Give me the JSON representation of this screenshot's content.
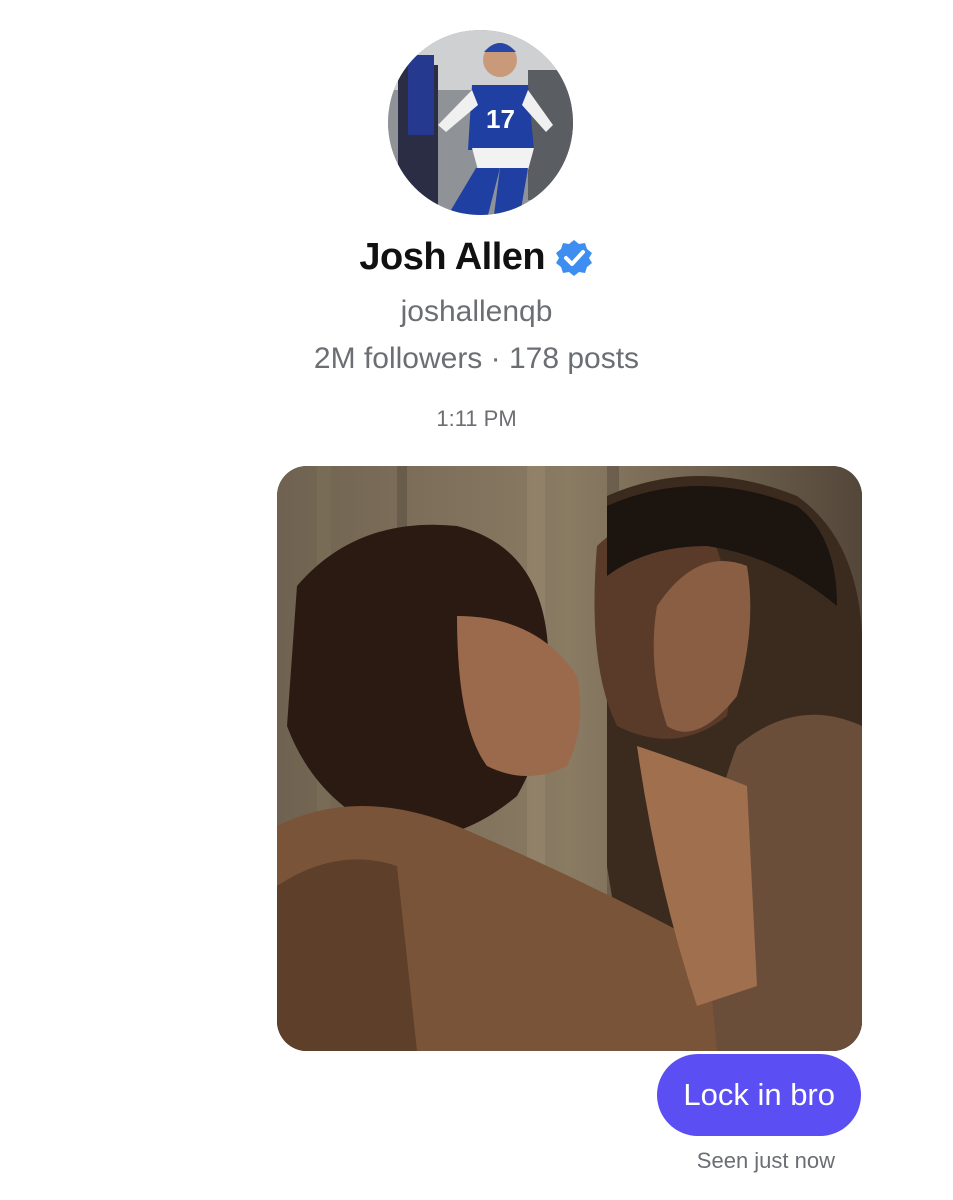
{
  "profile": {
    "name": "Josh Allen",
    "verified": true,
    "handle": "joshallenqb",
    "stats": "2M followers · 178 posts",
    "avatar_icon": "profile-photo-football-player"
  },
  "thread": {
    "timestamp": "1:11 PM",
    "shared_image_icon": "photo-couple-embrace",
    "message": "Lock in bro",
    "seen_status": "Seen just now"
  },
  "colors": {
    "bubble": "#5b4ef2",
    "verified_badge": "#3d8ef0",
    "secondary_text": "#6b6e73"
  }
}
